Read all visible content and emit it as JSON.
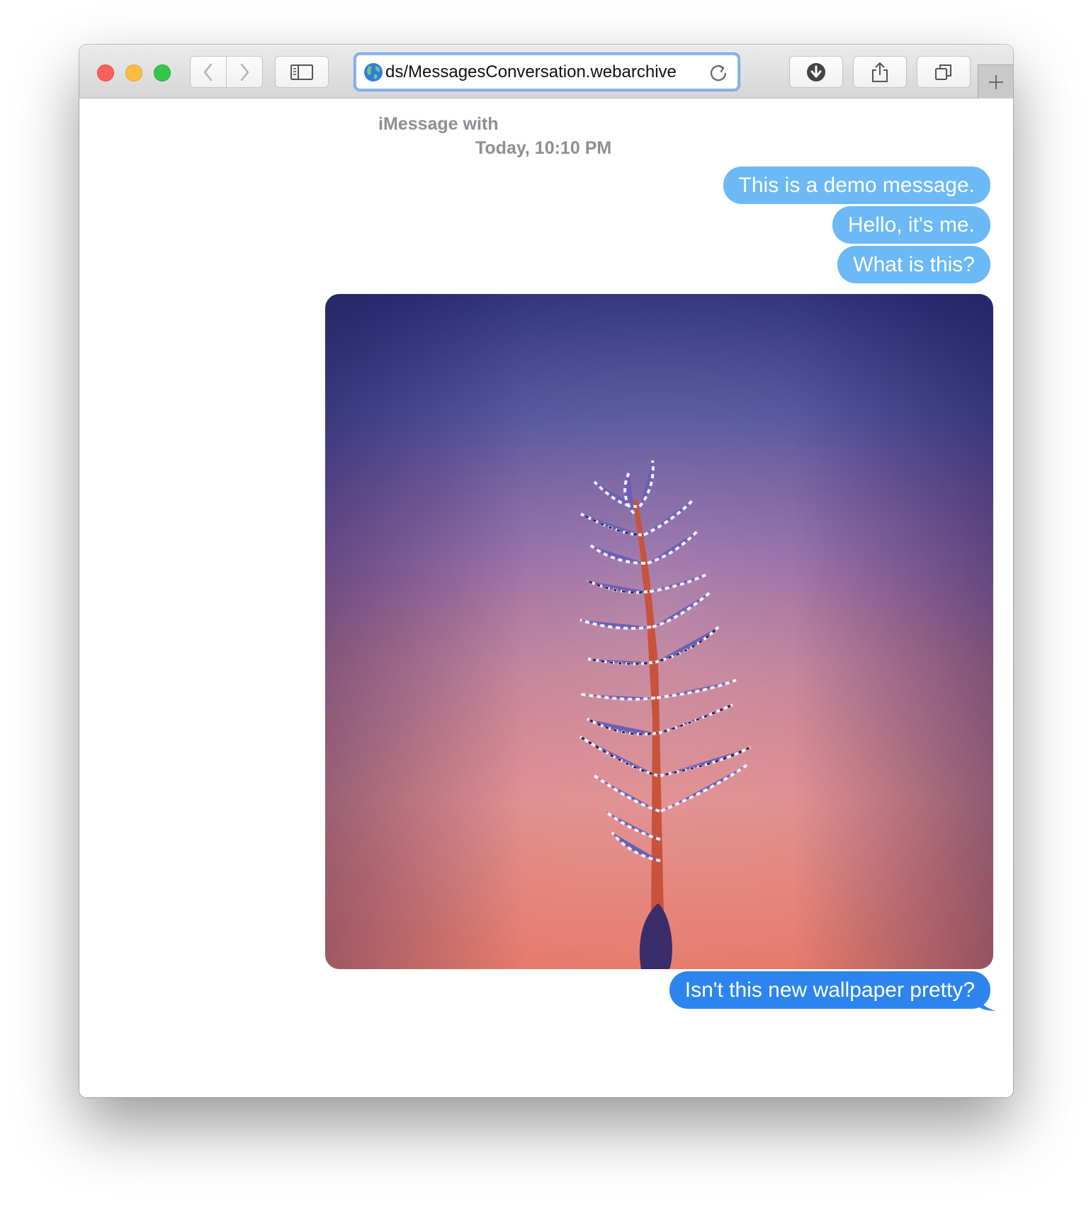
{
  "browser": {
    "url": "ds/MessagesConversation.webarchive",
    "buttons": [
      "back",
      "forward",
      "sidebar",
      "downloads",
      "share",
      "tabs",
      "new-tab"
    ]
  },
  "conversation": {
    "header_line1": "iMessage with",
    "header_line2": "Today, 10:10 PM",
    "messages": [
      "This is a demo message.",
      "Hello, it's me.",
      "What is this?",
      "Isn't this new wallpaper pretty?"
    ],
    "image": {
      "description_icon": "wallpaper-photo"
    }
  },
  "colors": {
    "bubble_light": "#6bb9f7",
    "bubble_dark": "#2c85ee",
    "header_text": "#8e8e93"
  }
}
